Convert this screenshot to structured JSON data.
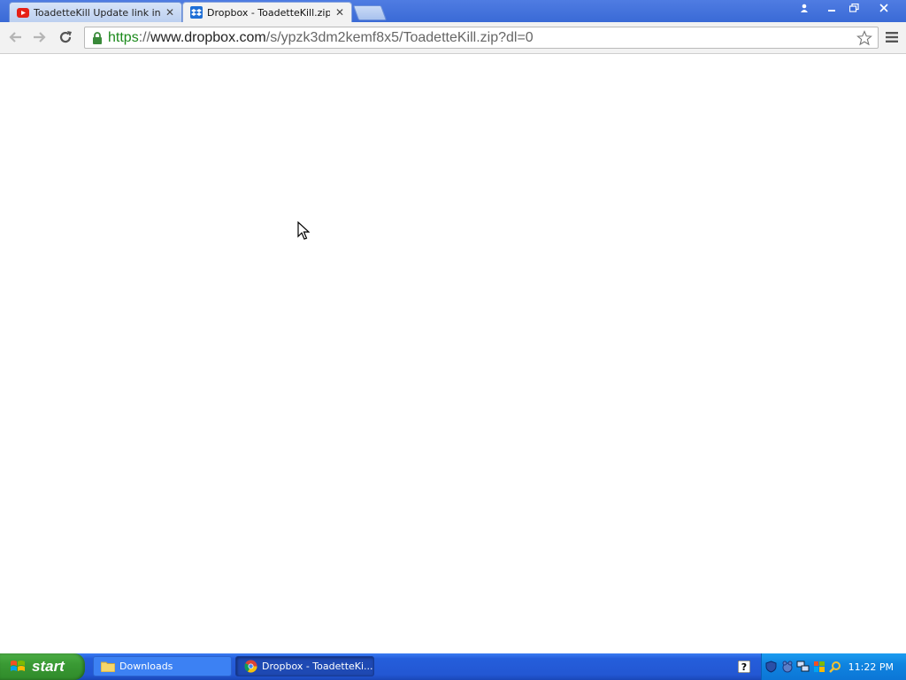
{
  "browser": {
    "tabs": [
      {
        "title": "ToadetteKill Update link in de",
        "favicon": "youtube-icon",
        "active": false
      },
      {
        "title": "Dropbox - ToadetteKill.zip - S",
        "favicon": "dropbox-icon",
        "active": true
      }
    ],
    "address_bar": {
      "scheme": "https",
      "separator": "://",
      "host": "www.dropbox.com",
      "path": "/s/ypzk3dm2kemf8x5/ToadetteKill.zip?dl=0"
    }
  },
  "taskbar": {
    "start_label": "start",
    "items": [
      {
        "label": "Downloads",
        "icon": "folder-icon",
        "active": false
      },
      {
        "label": "Dropbox - ToadetteKi...",
        "icon": "chrome-icon",
        "active": true
      }
    ],
    "clock": "11:22 PM"
  },
  "colors": {
    "url_scheme": "#1c8a1c",
    "tab_strip": "#3a6ad6",
    "taskbar": "#245edb",
    "start_button": "#3a9a34"
  }
}
